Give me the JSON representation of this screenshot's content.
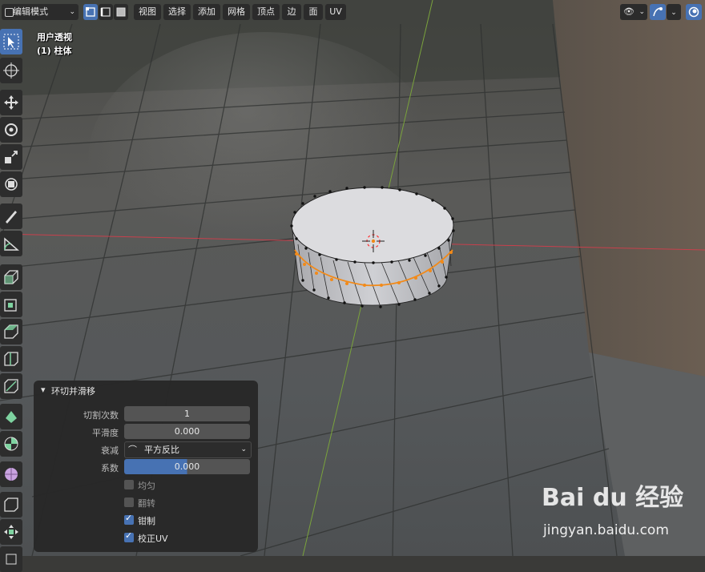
{
  "header": {
    "mode_label": "编辑模式",
    "menus": [
      "视图",
      "选择",
      "添加",
      "网格",
      "顶点",
      "边",
      "面",
      "UV"
    ]
  },
  "viewport": {
    "view_name": "用户透视",
    "object_name": "(1) 柱体"
  },
  "toolbar": {
    "tools": [
      "select-box-icon",
      "cursor-icon",
      "move-icon",
      "rotate-icon",
      "scale-icon",
      "transform-icon",
      "annotate-icon",
      "measure-icon",
      "extrude-icon",
      "inset-icon",
      "bevel-icon",
      "loop-cut-icon",
      "knife-icon",
      "poly-build-icon",
      "spin-icon",
      "smooth-icon",
      "shrink-fatten-icon",
      "shear-icon",
      "rip-icon"
    ]
  },
  "operator_panel": {
    "title": "环切并滑移",
    "fields": {
      "cuts_label": "切割次数",
      "cuts_value": "1",
      "smooth_label": "平滑度",
      "smooth_value": "0.000",
      "falloff_label": "衰减",
      "falloff_value": "平方反比",
      "factor_label": "系数",
      "factor_value": "0.000"
    },
    "checkboxes": {
      "even_label": "均匀",
      "even_checked": false,
      "flip_label": "翻转",
      "flip_checked": false,
      "clamp_label": "钳制",
      "clamp_checked": true,
      "correct_uv_label": "校正UV",
      "correct_uv_checked": true
    }
  },
  "watermark": {
    "logo": "Bai du 经验",
    "url": "jingyan.baidu.com"
  },
  "colors": {
    "accent": "#4772b3",
    "selected_edge": "#f28a19",
    "x_axis": "#c8404c",
    "y_axis": "#7aa33c"
  }
}
